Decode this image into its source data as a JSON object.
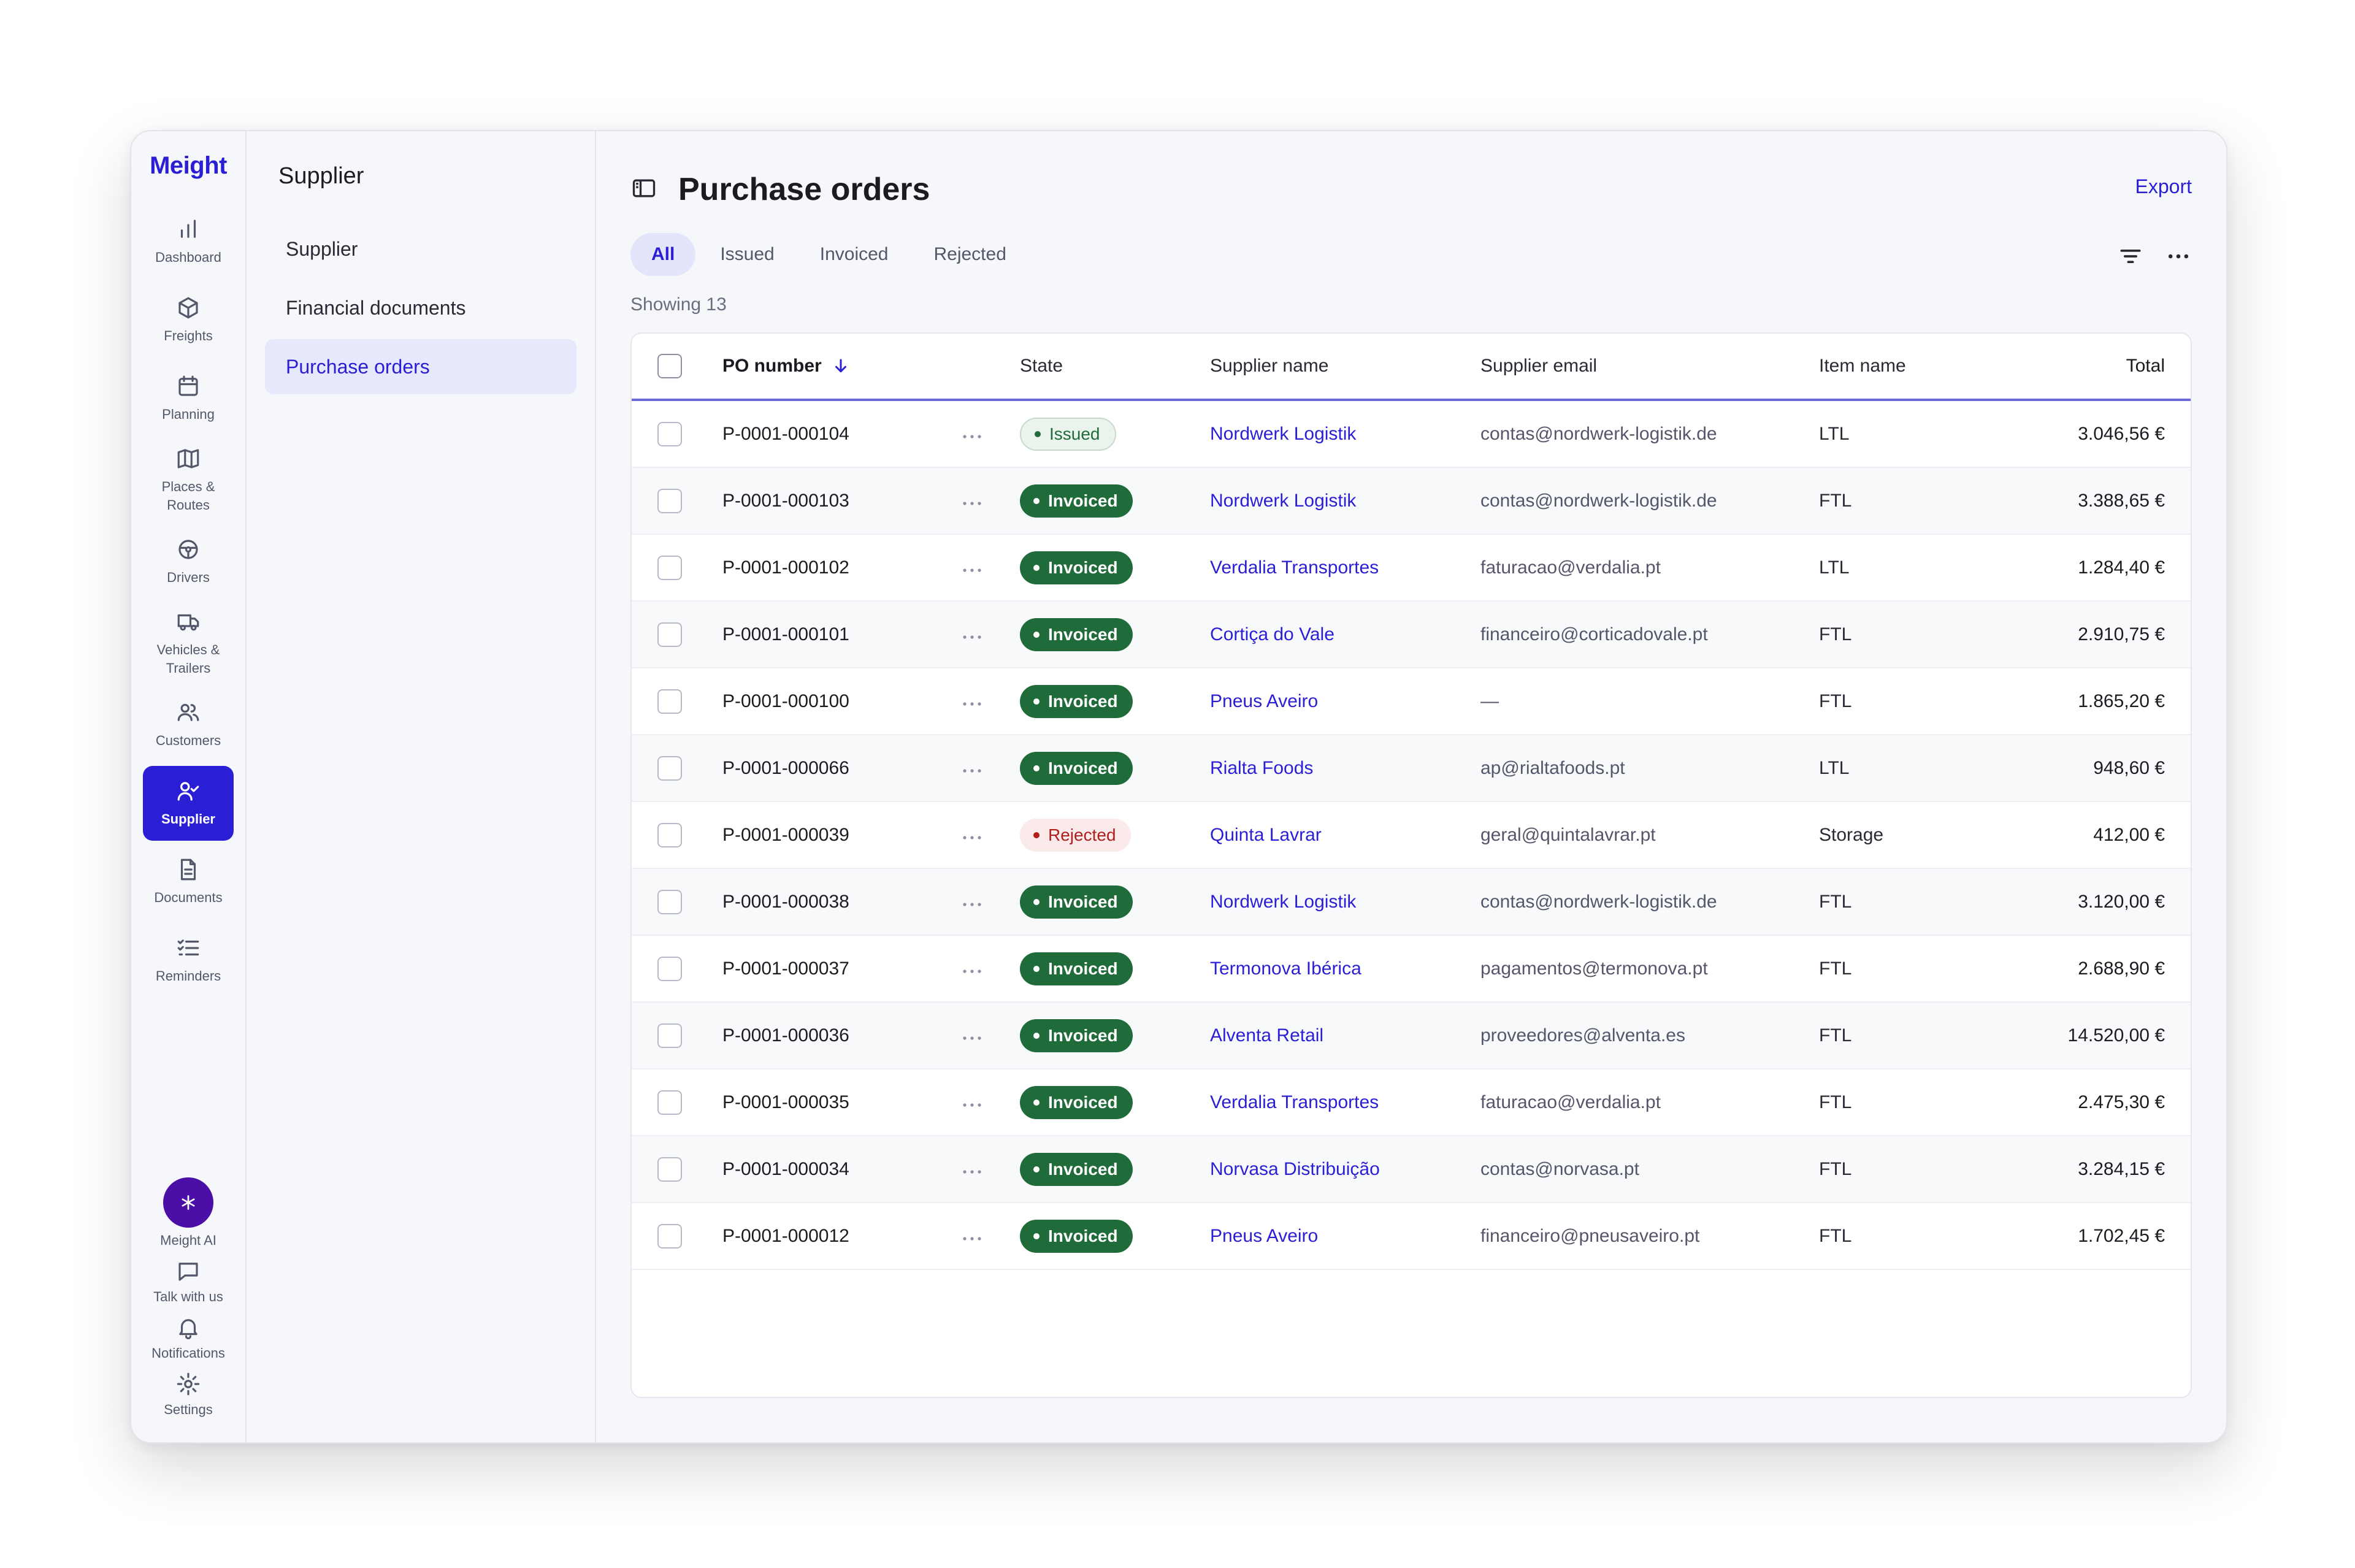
{
  "brand": "Meight",
  "rail": {
    "items": [
      {
        "label": "Dashboard",
        "icon": "bar-chart-icon"
      },
      {
        "label": "Freights",
        "icon": "box-icon"
      },
      {
        "label": "Planning",
        "icon": "calendar-icon"
      },
      {
        "label": "Places & Routes",
        "icon": "map-icon"
      },
      {
        "label": "Drivers",
        "icon": "steering-wheel-icon"
      },
      {
        "label": "Vehicles & Trailers",
        "icon": "truck-icon"
      },
      {
        "label": "Customers",
        "icon": "users-icon"
      },
      {
        "label": "Supplier",
        "icon": "user-check-icon",
        "active": true
      },
      {
        "label": "Documents",
        "icon": "document-icon"
      },
      {
        "label": "Reminders",
        "icon": "checklist-icon"
      }
    ],
    "bottom": [
      {
        "label": "Meight AI",
        "icon": "sparkle-icon"
      },
      {
        "label": "Talk with us",
        "icon": "chat-icon"
      },
      {
        "label": "Notifications",
        "icon": "bell-icon"
      },
      {
        "label": "Settings",
        "icon": "gear-icon"
      }
    ]
  },
  "subnav": {
    "title": "Supplier",
    "items": [
      {
        "label": "Supplier"
      },
      {
        "label": "Financial documents"
      },
      {
        "label": "Purchase orders",
        "active": true
      }
    ]
  },
  "main": {
    "title": "Purchase orders",
    "export_label": "Export",
    "tabs": [
      {
        "label": "All",
        "active": true
      },
      {
        "label": "Issued"
      },
      {
        "label": "Invoiced"
      },
      {
        "label": "Rejected"
      }
    ],
    "showing": "Showing 13"
  },
  "table": {
    "columns": {
      "po": "PO number",
      "state": "State",
      "supplier": "Supplier name",
      "email": "Supplier email",
      "item": "Item name",
      "total": "Total"
    },
    "rows": [
      {
        "po": "P-0001-000104",
        "state": "Issued",
        "supplier": "Nordwerk Logistik",
        "email": "contas@nordwerk-logistik.de",
        "item": "LTL",
        "total": "3.046,56 €"
      },
      {
        "po": "P-0001-000103",
        "state": "Invoiced",
        "supplier": "Nordwerk Logistik",
        "email": "contas@nordwerk-logistik.de",
        "item": "FTL",
        "total": "3.388,65 €"
      },
      {
        "po": "P-0001-000102",
        "state": "Invoiced",
        "supplier": "Verdalia Transportes",
        "email": "faturacao@verdalia.pt",
        "item": "LTL",
        "total": "1.284,40 €"
      },
      {
        "po": "P-0001-000101",
        "state": "Invoiced",
        "supplier": "Cortiça do Vale",
        "email": "financeiro@corticadovale.pt",
        "item": "FTL",
        "total": "2.910,75 €"
      },
      {
        "po": "P-0001-000100",
        "state": "Invoiced",
        "supplier": "Pneus Aveiro",
        "email": "—",
        "item": "FTL",
        "total": "1.865,20 €"
      },
      {
        "po": "P-0001-000066",
        "state": "Invoiced",
        "supplier": "Rialta Foods",
        "email": "ap@rialtafoods.pt",
        "item": "LTL",
        "total": "948,60 €"
      },
      {
        "po": "P-0001-000039",
        "state": "Rejected",
        "supplier": "Quinta Lavrar",
        "email": "geral@quintalavrar.pt",
        "item": "Storage",
        "total": "412,00 €"
      },
      {
        "po": "P-0001-000038",
        "state": "Invoiced",
        "supplier": "Nordwerk Logistik",
        "email": "contas@nordwerk-logistik.de",
        "item": "FTL",
        "total": "3.120,00 €"
      },
      {
        "po": "P-0001-000037",
        "state": "Invoiced",
        "supplier": "Termonova Ibérica",
        "email": "pagamentos@termonova.pt",
        "item": "FTL",
        "total": "2.688,90 €"
      },
      {
        "po": "P-0001-000036",
        "state": "Invoiced",
        "supplier": "Alventa Retail",
        "email": "proveedores@alventa.es",
        "item": "FTL",
        "total": "14.520,00 €"
      },
      {
        "po": "P-0001-000035",
        "state": "Invoiced",
        "supplier": "Verdalia Transportes",
        "email": "faturacao@verdalia.pt",
        "item": "FTL",
        "total": "2.475,30 €"
      },
      {
        "po": "P-0001-000034",
        "state": "Invoiced",
        "supplier": "Norvasa Distribuição",
        "email": "contas@norvasa.pt",
        "item": "FTL",
        "total": "3.284,15 €"
      },
      {
        "po": "P-0001-000012",
        "state": "Invoiced",
        "supplier": "Pneus Aveiro",
        "email": "financeiro@pneusaveiro.pt",
        "item": "FTL",
        "total": "1.702,45 €"
      }
    ]
  },
  "colors": {
    "accent": "#2b1fd6",
    "invoiced": "#1f6b3a",
    "rejected": "#b11e1e",
    "ai": "#4b0fa8"
  }
}
